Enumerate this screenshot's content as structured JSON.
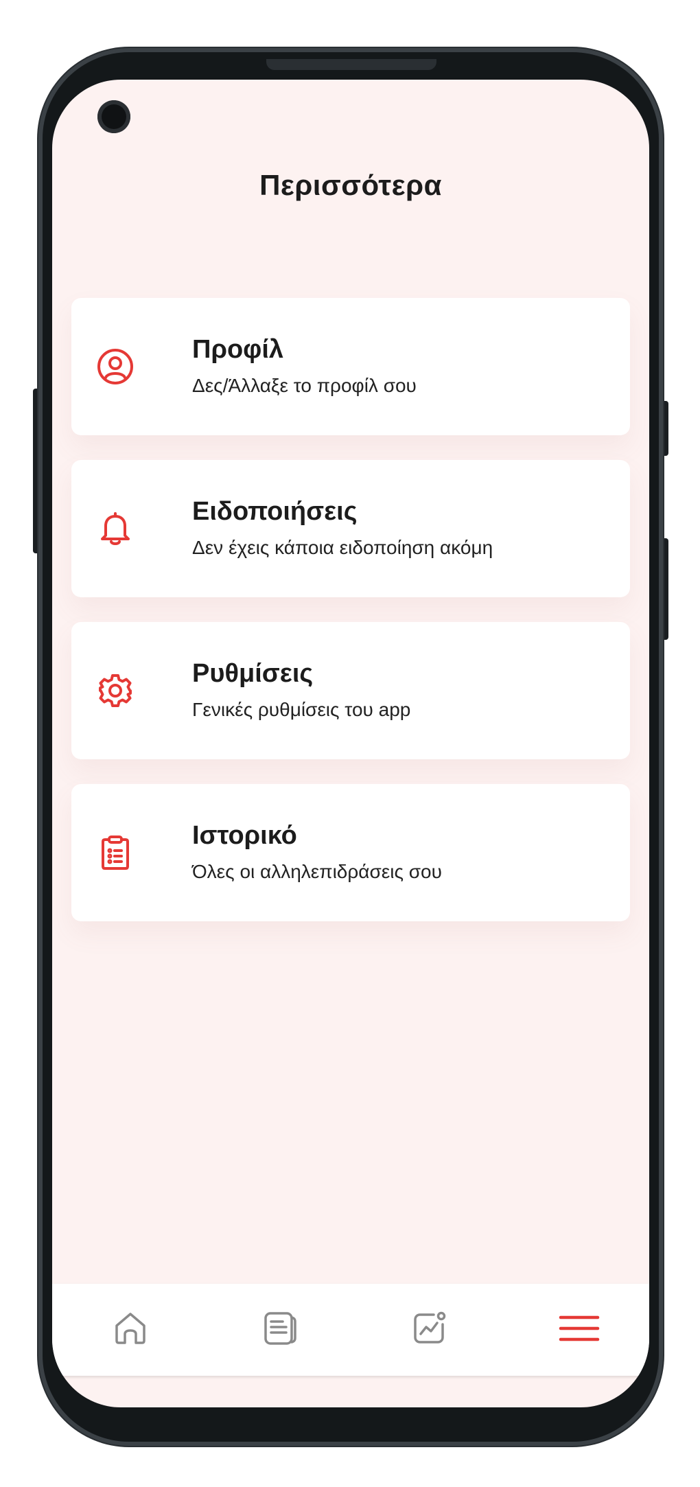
{
  "header": {
    "title": "Περισσότερα"
  },
  "menu": {
    "items": [
      {
        "title": "Προφίλ",
        "subtitle": "Δες/Άλλαξε το προφίλ σου",
        "icon": "user-circle-icon"
      },
      {
        "title": "Ειδοποιήσεις",
        "subtitle": "Δεν έχεις κάποια ειδοποίηση ακόμη",
        "icon": "bell-icon"
      },
      {
        "title": "Ρυθμίσεις",
        "subtitle": "Γενικές ρυθμίσεις του app",
        "icon": "gear-icon"
      },
      {
        "title": "Ιστορικό",
        "subtitle": "Όλες οι αλληλεπιδράσεις σου",
        "icon": "clipboard-list-icon"
      }
    ]
  },
  "bottom_nav": {
    "items": [
      {
        "icon": "home-icon",
        "active": false
      },
      {
        "icon": "document-icon",
        "active": false
      },
      {
        "icon": "chart-icon",
        "active": false
      },
      {
        "icon": "hamburger-menu-icon",
        "active": true
      }
    ]
  },
  "colors": {
    "accent": "#e53935",
    "inactive_icon": "#8a8a8a",
    "screen_background": "#fdf2f1",
    "card_background": "#ffffff",
    "text_primary": "#1c1c1c"
  }
}
